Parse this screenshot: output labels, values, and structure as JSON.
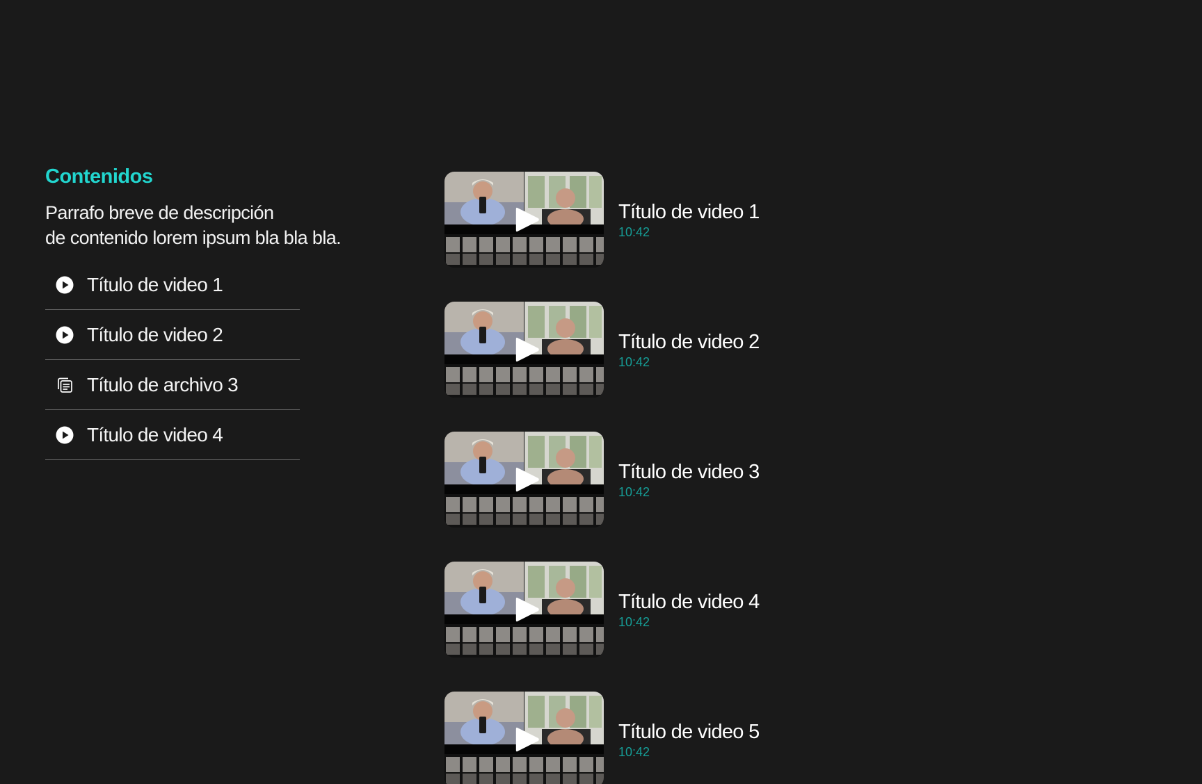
{
  "section": {
    "title": "Contenidos",
    "description": "Parrafo breve de descripción\nde contenido lorem ipsum bla bla bla."
  },
  "content_list": [
    {
      "label": "Título de video 1",
      "icon": "play-circle-icon"
    },
    {
      "label": "Título de video 2",
      "icon": "play-circle-icon"
    },
    {
      "label": "Título de archivo 3",
      "icon": "file-stack-icon"
    },
    {
      "label": "Título de video 4",
      "icon": "play-circle-icon"
    }
  ],
  "videos": [
    {
      "title": "Título de video 1",
      "duration": "10:42"
    },
    {
      "title": "Título de video 2",
      "duration": "10:42"
    },
    {
      "title": "Título de video 3",
      "duration": "10:42"
    },
    {
      "title": "Título de video 4",
      "duration": "10:42"
    },
    {
      "title": "Título de video 5",
      "duration": "10:42"
    }
  ],
  "colors": {
    "background": "#1a1a1a",
    "accent": "#22d6cf",
    "duration": "#169d96",
    "divider": "#6a6a6a"
  }
}
